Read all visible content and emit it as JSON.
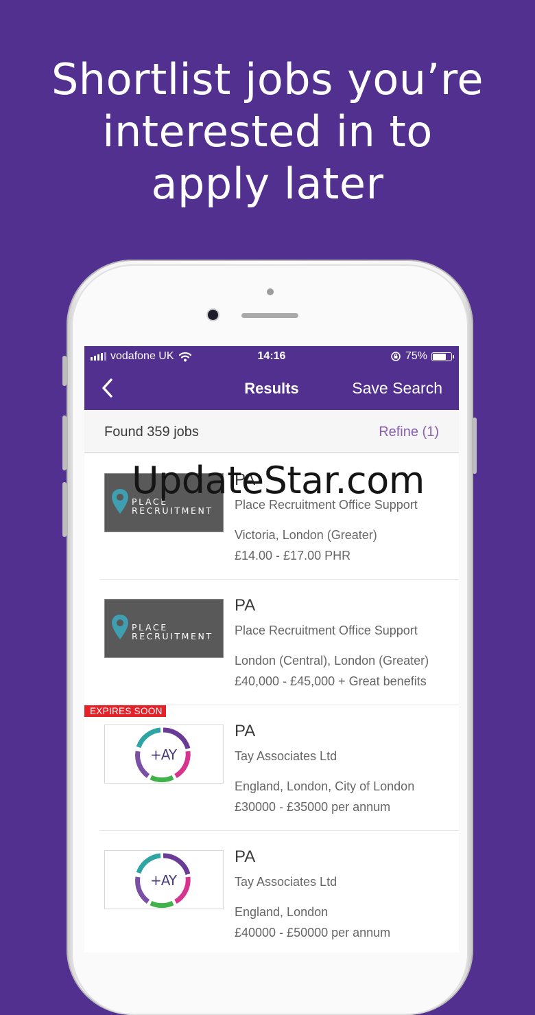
{
  "headline": {
    "line1": "Shortlist jobs you’re",
    "line2": "interested in to",
    "line3": "apply later"
  },
  "status_bar": {
    "carrier": "vodafone UK",
    "time": "14:16",
    "battery_percent": "75%",
    "battery_level": 0.75
  },
  "nav": {
    "title": "Results",
    "save_search": "Save Search",
    "back_icon": "chevron-left-icon"
  },
  "summary": {
    "found": "Found 359 jobs",
    "refine": "Refine (1)"
  },
  "jobs": [
    {
      "title": "PA",
      "company": "Place Recruitment Office Support",
      "location": "Victoria, London (Greater)",
      "salary": "£14.00 - £17.00 PHR",
      "logo_text_1": "PLACE",
      "logo_text_2": "RECRUITMENT",
      "badge": ""
    },
    {
      "title": "PA",
      "company": "Place Recruitment Office Support",
      "location": "London (Central), London (Greater)",
      "salary": "£40,000 - £45,000 + Great benefits",
      "logo_text_1": "PLACE",
      "logo_text_2": "RECRUITMENT",
      "badge": ""
    },
    {
      "title": "PA",
      "company": "Tay Associates Ltd",
      "location": "England, London, City of London",
      "salary": "£30000 - £35000 per annum",
      "logo_text": "+AY",
      "badge": "EXPIRES SOON"
    },
    {
      "title": "PA",
      "company": "Tay Associates Ltd",
      "location": "England, London",
      "salary": "£40000 - £50000 per annum",
      "logo_text": "+AY",
      "badge": ""
    }
  ],
  "watermark": "UpdateStar.com",
  "colors": {
    "brand_purple": "#52308f",
    "refine_purple": "#8a5fb0",
    "expires_red": "#e52229",
    "pin_teal": "#3f9eb0"
  }
}
